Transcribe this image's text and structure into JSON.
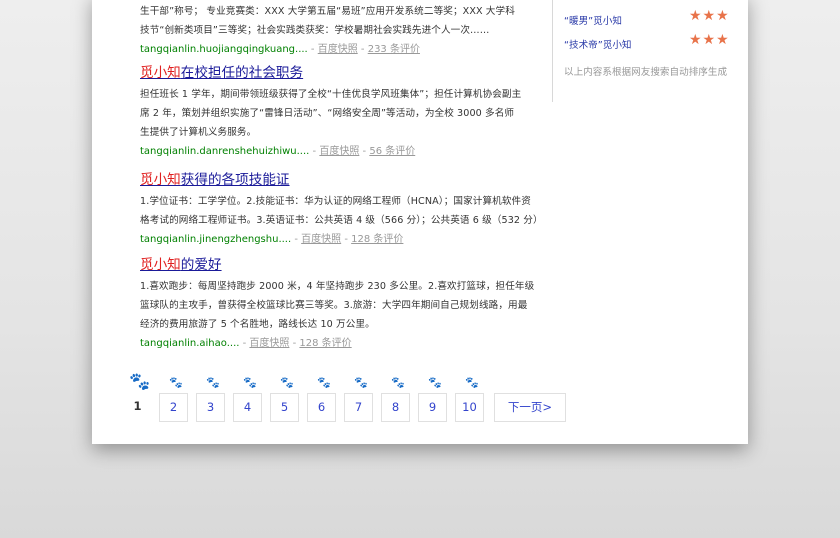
{
  "results": [
    {
      "title_highlight": "",
      "title_rest": "",
      "desc_lines": [
        "生干部”称号； 专业竞赛类：XXX 大学第五届“易班”应用开发系统二等奖；XXX 大学科",
        "技节“创新类项目”三等奖；社会实践类获奖：学校暑期社会实践先进个人一次……"
      ],
      "url": "tangqianlin.huojiangqingkuang....",
      "cache": "百度快照",
      "comments": "233 条评价"
    },
    {
      "title_highlight": "觅小知",
      "title_rest": "在校担任的社会职务",
      "desc_lines": [
        "担任班长 1 学年，期间带领班级获得了全校“十佳优良学风班集体”；担任计算机协会副主",
        "席 2 年，策划并组织实施了“雷锋日活动”、“网络安全周”等活动，为全校 3000 多名师",
        "生提供了计算机义务服务。"
      ],
      "url": "tangqianlin.danrenshehuizhiwu....",
      "cache": "百度快照",
      "comments": "56 条评价"
    },
    {
      "title_highlight": "觅小知",
      "title_rest": "获得的各项技能证",
      "desc_lines": [
        "1.学位证书：工学学位。2.技能证书：华为认证的网络工程师（HCNA）；国家计算机软件资",
        "格考试的网络工程师证书。3.英语证书：公共英语 4 级（566 分）；公共英语 6 级（532 分）"
      ],
      "url": "tangqianlin.jinengzhengshu....",
      "cache": "百度快照",
      "comments": "128 条评价"
    },
    {
      "title_highlight": "觅小知",
      "title_rest": "的爱好",
      "desc_lines": [
        "1.喜欢跑步：每周坚持跑步 2000 米，4 年坚持跑步 230 多公里。2.喜欢打篮球，担任年级",
        "篮球队的主攻手，曾获得全校篮球比赛三等奖。3.旅游：大学四年期间自己规划线路，用最",
        "经济的费用旅游了 5 个名胜地，路线长达 10 万公里。"
      ],
      "url": "tangqianlin.aihao....",
      "cache": "百度快照",
      "comments": "128 条评价"
    }
  ],
  "meta_sep": "-",
  "sidebar": {
    "items": [
      {
        "label": "“暖男”觅小知",
        "stars": "★★★"
      },
      {
        "label": "“技术帝”觅小知",
        "stars": "★★★"
      }
    ],
    "note": "以上内容系根据网友搜索自动排序生成"
  },
  "pager": {
    "current": "1",
    "pages": [
      "2",
      "3",
      "4",
      "5",
      "6",
      "7",
      "8",
      "9",
      "10"
    ],
    "next_label": "下一页>",
    "paw_glyph": "🐾"
  },
  "colors": {
    "highlight": "#e02020",
    "link": "#1a1a99",
    "url": "#008000",
    "stars": "#e8734a"
  }
}
